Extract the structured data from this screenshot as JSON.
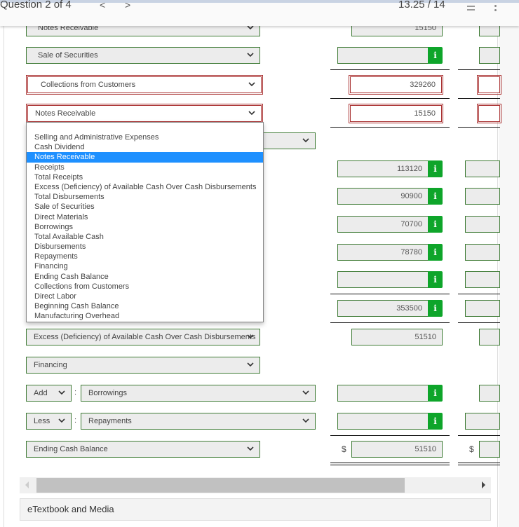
{
  "header": {
    "question_label": "Question 2 of 4",
    "prev_glyph": "<",
    "next_glyph": ">",
    "score": "13.25 / 14"
  },
  "rows": [
    {
      "label": "Notes Receivable",
      "value": "15150",
      "state": "correct"
    },
    {
      "label": "Sale of Securities",
      "value": "",
      "state": "correct",
      "info": true
    },
    {
      "label": "Collections from Customers",
      "value": "329260",
      "state": "incorrect"
    },
    {
      "label": "Notes Receivable",
      "value": "15150",
      "state": "incorrect",
      "open": true
    },
    {
      "label": "",
      "value": "",
      "state": "correct"
    },
    {
      "label": "",
      "value": "113120",
      "info": true
    },
    {
      "label": "",
      "value": "90900",
      "info": true
    },
    {
      "label": "",
      "value": "70700",
      "info": true
    },
    {
      "label": "",
      "value": "78780",
      "info": true
    },
    {
      "label": "",
      "value": "",
      "info": true
    },
    {
      "label": "",
      "value": "353500",
      "info": true
    },
    {
      "label": "Excess (Deficiency) of Available Cash Over Cash Disbursements",
      "value": "51510"
    },
    {
      "label": "Financing",
      "value": ""
    },
    {
      "prefix": "Add",
      "label": "Borrowings",
      "value": "",
      "info": true
    },
    {
      "prefix": "Less",
      "label": "Repayments",
      "value": "",
      "info": true
    },
    {
      "label": "Ending Cash Balance",
      "value": "51510",
      "currency": "$"
    }
  ],
  "dropdown": {
    "selected": "Notes Receivable",
    "options": [
      "Selling and Administrative Expenses",
      "Cash Dividend",
      "Notes Receivable",
      "Receipts",
      "Total Receipts",
      "Excess (Deficiency) of Available Cash Over Cash Disbursements",
      "Total Disbursements",
      "Sale of Securities",
      "Direct Materials",
      "Borrowings",
      "Total Available Cash",
      "Disbursements",
      "Repayments",
      "Financing",
      "Ending Cash Balance",
      "Collections from Customers",
      "Direct Labor",
      "Beginning Cash Balance",
      "Manufacturing Overhead"
    ]
  },
  "info_glyph": "i",
  "footer": {
    "etextbook_label": "eTextbook and Media"
  },
  "colors": {
    "correct_border": "#3d7a34",
    "incorrect_border": "#aa3333",
    "info_green": "#0ea52a",
    "highlight_blue": "#1e90ff"
  }
}
